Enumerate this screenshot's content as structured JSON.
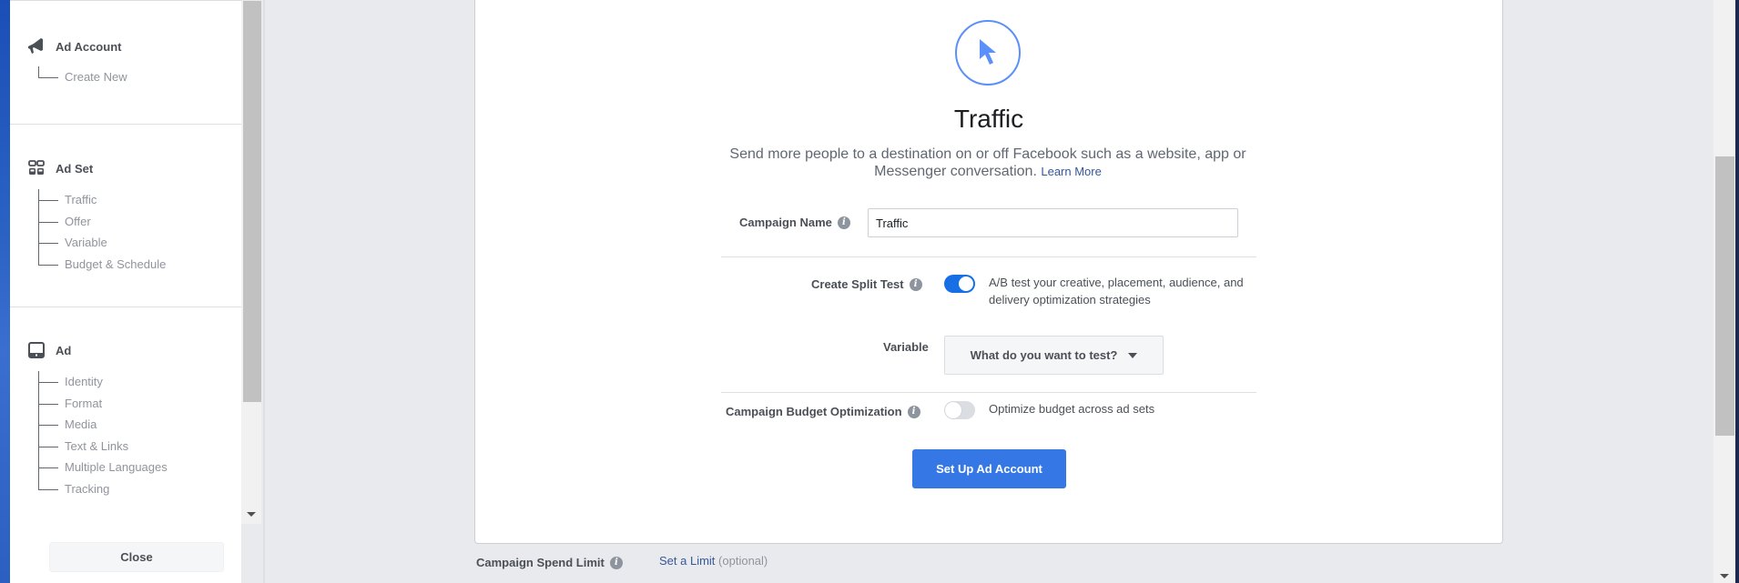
{
  "sidebar": {
    "sections": [
      {
        "title": "Ad Account",
        "icon": "megaphone-icon",
        "items": [
          "Create New"
        ]
      },
      {
        "title": "Ad Set",
        "icon": "grid-icon",
        "items": [
          "Traffic",
          "Offer",
          "Variable",
          "Budget & Schedule"
        ]
      },
      {
        "title": "Ad",
        "icon": "ad-preview-icon",
        "items": [
          "Identity",
          "Format",
          "Media",
          "Text & Links",
          "Multiple Languages",
          "Tracking"
        ]
      }
    ],
    "close_label": "Close"
  },
  "objective": {
    "icon": "cursor-icon",
    "title": "Traffic",
    "description": "Send more people to a destination on or off Facebook such as a website, app or Messenger conversation.",
    "learn_more": "Learn More"
  },
  "form": {
    "campaign_name": {
      "label": "Campaign Name",
      "value": "Traffic"
    },
    "split_test": {
      "label": "Create Split Test",
      "enabled": true,
      "helper": "A/B test your creative, placement, audience, and delivery optimization strategies"
    },
    "variable": {
      "label": "Variable",
      "selected": "What do you want to test?"
    },
    "budget_optimization": {
      "label": "Campaign Budget Optimization",
      "enabled": false,
      "helper": "Optimize budget across ad sets"
    },
    "submit_label": "Set Up Ad Account"
  },
  "spend_limit": {
    "label": "Campaign Spend Limit",
    "link": "Set a Limit",
    "optional": "(optional)"
  },
  "colors": {
    "primary": "#3578e5",
    "link": "#365899",
    "icon_accent": "#5b8ff9",
    "toggle_on": "#166fe5"
  }
}
